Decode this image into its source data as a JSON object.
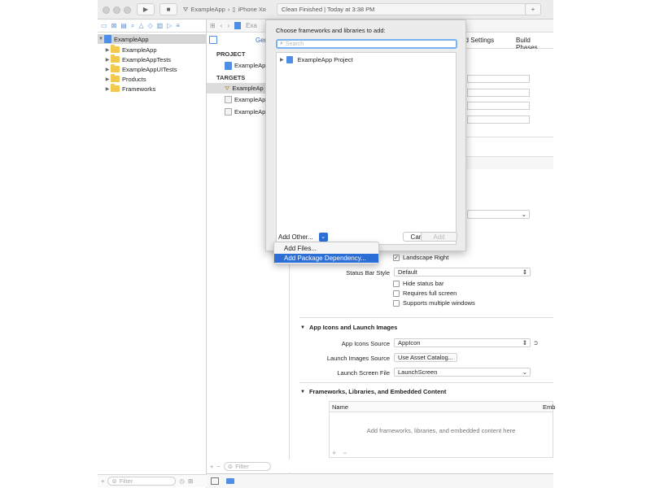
{
  "toolbar": {
    "scheme_app": "ExampleApp",
    "scheme_device": "iPhone Xʀ",
    "status": "Clean Finished | Today at 3:38 PM"
  },
  "navigator": {
    "items": [
      {
        "label": "ExampleApp"
      },
      {
        "label": "ExampleApp"
      },
      {
        "label": "ExampleAppTests"
      },
      {
        "label": "ExampleAppUITests"
      },
      {
        "label": "Products"
      },
      {
        "label": "Frameworks"
      }
    ],
    "filter_placeholder": "Filter"
  },
  "editor_bar": {
    "crumb": "Exa"
  },
  "targets_list": {
    "project_header": "PROJECT",
    "project_item": "ExampleAp",
    "targets_header": "TARGETS",
    "targets": [
      "ExampleAp",
      "ExampleAp",
      "ExampleAp"
    ],
    "filter_placeholder": "Filter",
    "general_tab": "Gen"
  },
  "tabs": {
    "build_settings": "ild Settings",
    "build_phases": "Build Phases"
  },
  "deployment": {
    "landscape_right": "Landscape Right",
    "status_bar_style_label": "Status Bar Style",
    "status_bar_style_value": "Default",
    "hide_status_bar": "Hide status bar",
    "requires_full_screen": "Requires full screen",
    "supports_multiple_windows": "Supports multiple windows"
  },
  "app_icons": {
    "title": "App Icons and Launch Images",
    "icons_source_label": "App Icons Source",
    "icons_source_value": "AppIcon",
    "launch_images_label": "Launch Images Source",
    "launch_images_button": "Use Asset Catalog...",
    "launch_screen_label": "Launch Screen File",
    "launch_screen_value": "LaunchScreen"
  },
  "frameworks": {
    "title": "Frameworks, Libraries, and Embedded Content",
    "col_name": "Name",
    "col_embed": "Emb",
    "empty": "Add frameworks, libraries, and embedded content here",
    "add": "+",
    "remove": "−"
  },
  "sheet": {
    "title": "Choose frameworks and libraries to add:",
    "search_placeholder": "Search",
    "list_item": "ExampleApp Project",
    "add_other": "Add Other...",
    "cancel": "Cancel",
    "add": "Add"
  },
  "menu": {
    "items": [
      "Add Files...",
      "Add Package Dependency..."
    ]
  },
  "colors": {
    "accent": "#2b6fd6",
    "search_focus": "#7ab2ef",
    "folder": "#f2c94c",
    "project": "#4f8ee6"
  }
}
